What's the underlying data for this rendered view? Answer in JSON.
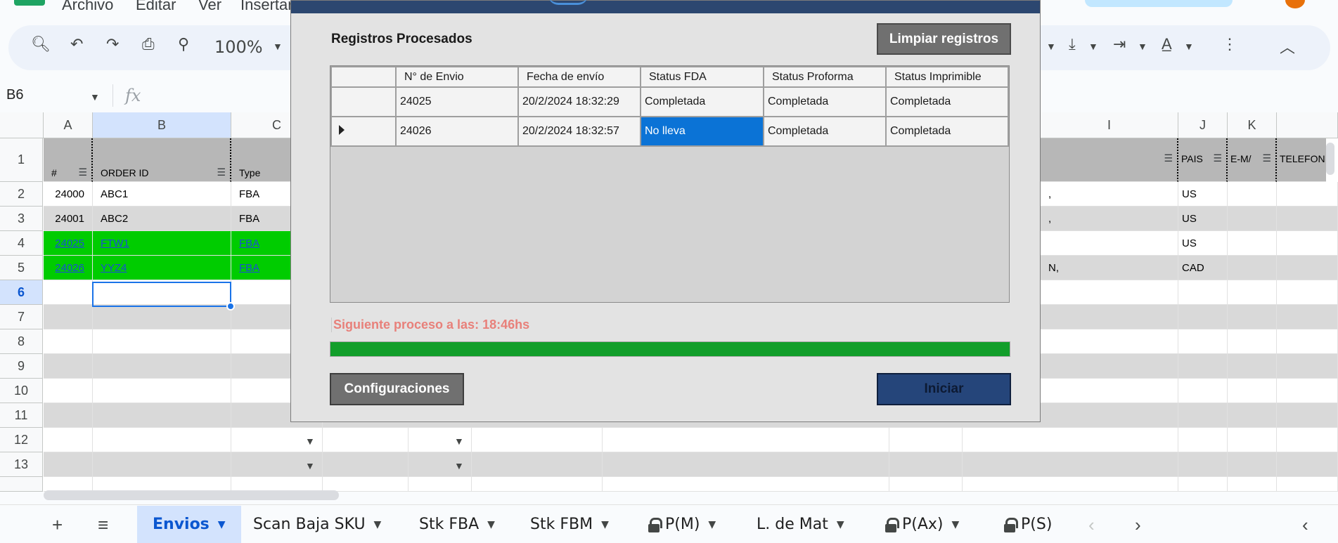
{
  "menu": {
    "items": [
      "Archivo",
      "Editar",
      "Ver",
      "Insertar"
    ]
  },
  "toolbar": {
    "zoom": "100%"
  },
  "formula_bar": {
    "name_box": "B6",
    "fx": "fx"
  },
  "grid": {
    "columns": [
      "A",
      "B",
      "C",
      "I",
      "J",
      "K"
    ],
    "rows": [
      "1",
      "2",
      "3",
      "4",
      "5",
      "6",
      "7",
      "8",
      "9",
      "10",
      "11",
      "12",
      "13"
    ],
    "header_row": {
      "a": "#",
      "b": "ORDER ID",
      "c": "Type",
      "j": "PAIS",
      "k": "E-M/",
      "l": "TELEFON"
    },
    "data": [
      {
        "a": "24000",
        "b": "ABC1",
        "c": "FBA",
        "i": ",",
        "j": "US"
      },
      {
        "a": "24001",
        "b": "ABC2",
        "c": "FBA",
        "i": ",",
        "j": "US"
      },
      {
        "a": "24025",
        "b": "FTW1",
        "c": "FBA",
        "i": "",
        "j": "US"
      },
      {
        "a": "24026",
        "b": "YYZ4",
        "c": "FBA",
        "i": "N,",
        "j": "CAD"
      }
    ]
  },
  "sheet_tabs": [
    {
      "label": "Envios",
      "active": true,
      "locked": false
    },
    {
      "label": "Scan Baja SKU",
      "active": false,
      "locked": false
    },
    {
      "label": "Stk FBA",
      "active": false,
      "locked": false
    },
    {
      "label": "Stk FBM",
      "active": false,
      "locked": false
    },
    {
      "label": "P(M)",
      "active": false,
      "locked": true
    },
    {
      "label": "L. de Mat",
      "active": false,
      "locked": false
    },
    {
      "label": "P(Ax)",
      "active": false,
      "locked": true
    },
    {
      "label": "P(S)",
      "active": false,
      "locked": true
    }
  ],
  "modal": {
    "title": "Registros Procesados",
    "clear_button": "Limpiar registros",
    "table": {
      "headers": [
        "N° de Envio",
        "Fecha de envío",
        "Status FDA",
        "Status Proforma",
        "Status Imprimible"
      ],
      "rows": [
        {
          "envio": "24025",
          "fecha": "20/2/2024 18:32:29",
          "fda": "Completada",
          "proforma": "Completada",
          "imprimible": "Completada"
        },
        {
          "envio": "24026",
          "fecha": "20/2/2024 18:32:57",
          "fda": "No lleva",
          "proforma": "Completada",
          "imprimible": "Completada"
        }
      ]
    },
    "next_process": "Siguiente proceso a las: 18:46hs",
    "progress": 1.0,
    "config_button": "Configuraciones",
    "start_button": "Iniciar"
  }
}
